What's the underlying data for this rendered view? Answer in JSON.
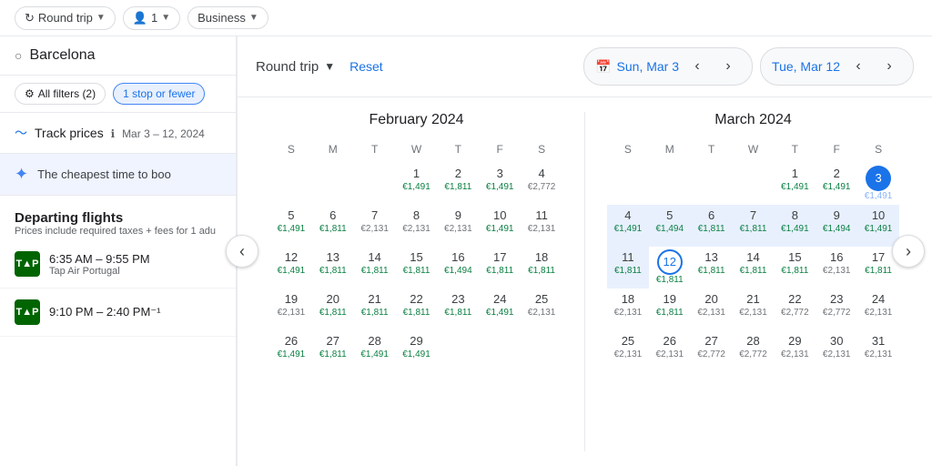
{
  "topNav": {
    "roundTrip": "Round trip",
    "passengers": "1",
    "class": "Business"
  },
  "leftPanel": {
    "searchCity": "Barcelona",
    "filtersLabel": "All filters (2)",
    "stopFilter": "1 stop or fewer",
    "trackPrices": "Track prices",
    "trackDates": "Mar 3 – 12, 2024",
    "cheapestBanner": "The cheapest time to boo",
    "departingFlights": "Departing flights",
    "flightsSub": "Prices include required taxes + fees for 1 adu",
    "flights": [
      {
        "time": "6:35 AM – 9:55 PM",
        "airline": "Tap Air Portugal",
        "logo": "T▲P"
      },
      {
        "time": "9:10 PM – 2:40 PM⁻¹",
        "airline": "",
        "logo": "T▲P"
      }
    ]
  },
  "calendar": {
    "tripType": "Round trip",
    "resetLabel": "Reset",
    "calendarIcon": "📅",
    "startDate": "Sun, Mar 3",
    "endDate": "Tue, Mar 12",
    "feb": {
      "title": "February 2024",
      "dows": [
        "S",
        "M",
        "T",
        "W",
        "T",
        "F",
        "S"
      ],
      "startDow": 3,
      "days": [
        {
          "n": "1",
          "p": "€1,491"
        },
        {
          "n": "2",
          "p": "€1,811"
        },
        {
          "n": "3",
          "p": "€1,491"
        },
        {
          "n": "4",
          "p": "€2,772"
        },
        {
          "n": "5",
          "p": "€1,491"
        },
        {
          "n": "6",
          "p": "€1,811"
        },
        {
          "n": "7",
          "p": "€2,131"
        },
        {
          "n": "8",
          "p": "€2,131"
        },
        {
          "n": "9",
          "p": "€2,131"
        },
        {
          "n": "10",
          "p": "€1,491"
        },
        {
          "n": "11",
          "p": "€2,131"
        },
        {
          "n": "12",
          "p": "€1,491"
        },
        {
          "n": "13",
          "p": "€1,811"
        },
        {
          "n": "14",
          "p": "€1,811"
        },
        {
          "n": "15",
          "p": "€1,811"
        },
        {
          "n": "16",
          "p": "€1,494"
        },
        {
          "n": "17",
          "p": "€1,811"
        },
        {
          "n": "18",
          "p": "€1,811"
        },
        {
          "n": "19",
          "p": "€2,131"
        },
        {
          "n": "20",
          "p": "€1,811"
        },
        {
          "n": "21",
          "p": "€1,811"
        },
        {
          "n": "22",
          "p": "€1,811"
        },
        {
          "n": "23",
          "p": "€1,811"
        },
        {
          "n": "24",
          "p": "€1,491"
        },
        {
          "n": "25",
          "p": "€2,131"
        },
        {
          "n": "26",
          "p": "€1,491"
        },
        {
          "n": "27",
          "p": "€1,811"
        },
        {
          "n": "28",
          "p": "€1,491"
        },
        {
          "n": "29",
          "p": "€1,491"
        }
      ]
    },
    "mar": {
      "title": "March 2024",
      "dows": [
        "S",
        "M",
        "T",
        "W",
        "T",
        "F",
        "S"
      ],
      "startDow": 4,
      "days": [
        {
          "n": "1",
          "p": "€1,491"
        },
        {
          "n": "2",
          "p": "€1,491"
        },
        {
          "n": "3",
          "p": "€1,491",
          "sel": "start"
        },
        {
          "n": "4",
          "p": "€1,491"
        },
        {
          "n": "5",
          "p": "€1,494"
        },
        {
          "n": "6",
          "p": "€1,811"
        },
        {
          "n": "7",
          "p": "€1,811"
        },
        {
          "n": "8",
          "p": "€1,491"
        },
        {
          "n": "9",
          "p": "€1,494"
        },
        {
          "n": "10",
          "p": "€1,491"
        },
        {
          "n": "11",
          "p": "€1,811"
        },
        {
          "n": "12",
          "p": "€1,811",
          "sel": "end"
        },
        {
          "n": "13",
          "p": "€1,811"
        },
        {
          "n": "14",
          "p": "€1,811"
        },
        {
          "n": "15",
          "p": "€1,811"
        },
        {
          "n": "16",
          "p": "€2,131"
        },
        {
          "n": "17",
          "p": "€1,811"
        },
        {
          "n": "18",
          "p": "€2,131"
        },
        {
          "n": "19",
          "p": "€1,811"
        },
        {
          "n": "20",
          "p": "€2,131"
        },
        {
          "n": "21",
          "p": "€2,131"
        },
        {
          "n": "22",
          "p": "€2,772"
        },
        {
          "n": "23",
          "p": "€2,772"
        },
        {
          "n": "24",
          "p": "€2,131"
        },
        {
          "n": "25",
          "p": "€2,131"
        },
        {
          "n": "26",
          "p": "€2,131"
        },
        {
          "n": "27",
          "p": "€2,772"
        },
        {
          "n": "28",
          "p": "€2,772"
        },
        {
          "n": "29",
          "p": "€2,131"
        },
        {
          "n": "30",
          "p": "€2,131"
        },
        {
          "n": "31",
          "p": "€2,131"
        }
      ]
    }
  }
}
